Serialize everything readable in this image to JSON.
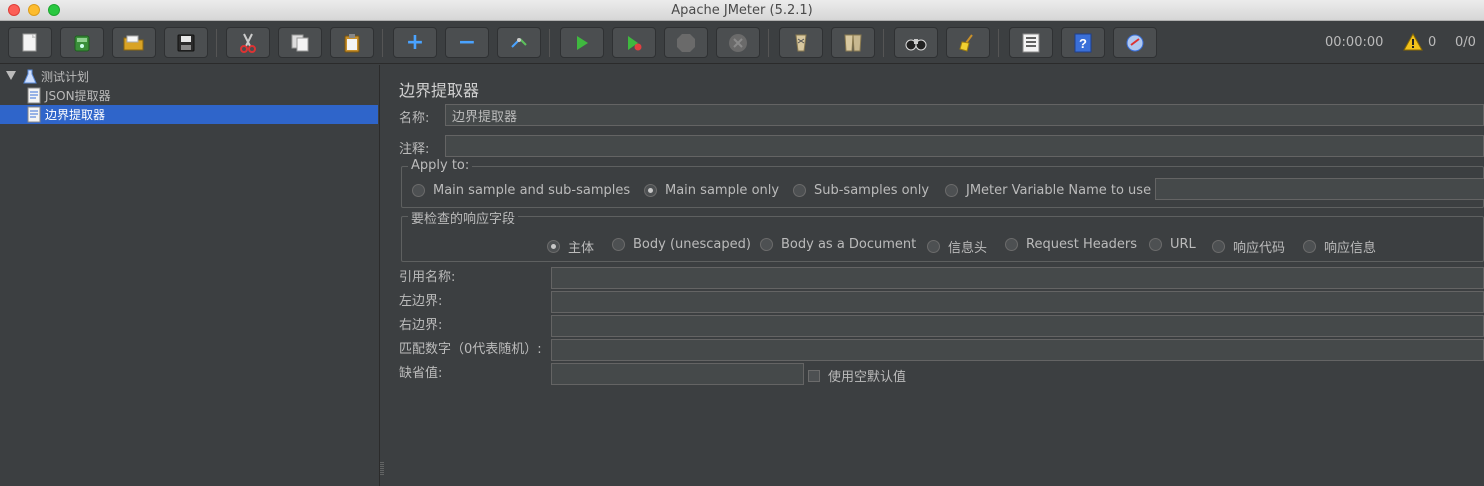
{
  "window": {
    "title": "Apache JMeter (5.2.1)"
  },
  "toolbar": {
    "buttons": [
      {
        "icon": "new-document-icon"
      },
      {
        "icon": "templates-icon"
      },
      {
        "icon": "open-folder-icon"
      },
      {
        "icon": "save-icon"
      },
      {
        "icon": "cut-icon"
      },
      {
        "icon": "copy-icon"
      },
      {
        "icon": "paste-icon"
      },
      {
        "icon": "expand-icon",
        "glyph": "+"
      },
      {
        "icon": "collapse-icon",
        "glyph": "−"
      },
      {
        "icon": "toggle-icon"
      },
      {
        "icon": "start-icon"
      },
      {
        "icon": "start-no-pause-icon"
      },
      {
        "icon": "stop-icon"
      },
      {
        "icon": "shutdown-icon"
      },
      {
        "icon": "clear-icon"
      },
      {
        "icon": "clear-all-icon"
      },
      {
        "icon": "search-binoculars-icon"
      },
      {
        "icon": "reset-search-broom-icon"
      },
      {
        "icon": "function-helper-icon"
      },
      {
        "icon": "help-icon"
      },
      {
        "icon": "remote-icon"
      }
    ],
    "elapsed_time": "00:00:00",
    "warning_count": "0",
    "threads": "0/0"
  },
  "tree": {
    "root": "测试计划",
    "children": [
      "JSON提取器",
      "边界提取器"
    ],
    "selected_index": 1
  },
  "panel": {
    "title": "边界提取器",
    "name_label": "名称:",
    "name_value": "边界提取器",
    "comment_label": "注释:",
    "comment_value": "",
    "apply_to": {
      "title": "Apply to:",
      "options": [
        "Main sample and sub-samples",
        "Main sample only",
        "Sub-samples only",
        "JMeter Variable Name to use"
      ],
      "selected": "Main sample only",
      "variable_value": ""
    },
    "field_to_check": {
      "title": "要检查的响应字段",
      "options": [
        "主体",
        "Body (unescaped)",
        "Body as a Document",
        "信息头",
        "Request Headers",
        "URL",
        "响应代码",
        "响应信息"
      ],
      "selected": "主体"
    },
    "ref_name_label": "引用名称:",
    "left_boundary_label": "左边界:",
    "right_boundary_label": "右边界:",
    "match_no_label": "匹配数字（0代表随机）:",
    "default_label": "缺省值:",
    "use_empty_default_label": "使用空默认值"
  }
}
